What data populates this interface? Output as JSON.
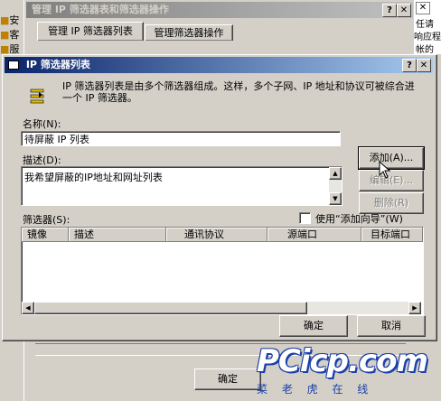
{
  "bg_window": {
    "title": "管理 IP 筛选器表和筛选器操作",
    "tabs": [
      "管理 IP 筛选器列表",
      "管理筛选器操作"
    ],
    "ok_label": "确定",
    "side_items": [
      "安",
      "客",
      "服"
    ],
    "right_items": [
      "任请",
      "响应程",
      "帐的"
    ]
  },
  "dialog": {
    "title": "IP 筛选器列表",
    "description": "IP 筛选器列表是由多个筛选器组成。这样，多个子网、IP 地址和协议可被综合进一个 IP 筛选器。",
    "name_label": "名称(N):",
    "name_value": "待屏蔽 IP 列表",
    "desc_label": "描述(D):",
    "desc_value": "我希望屏蔽的IP地址和网址列表",
    "buttons": {
      "add": "添加(A)...",
      "edit": "编辑(E)...",
      "delete": "删除(R)"
    },
    "filters_label": "筛选器(S):",
    "wizard_label": "使用“添加向导”(W)",
    "columns": [
      "镜像",
      "描述",
      "通讯协议",
      "源端口",
      "目标端口"
    ],
    "ok": "确定",
    "cancel": "取消"
  },
  "watermark": {
    "brand": "PCicp.com",
    "sub": "菜 老 虎 在 线"
  },
  "colors": {
    "title_active": "#0a246a",
    "face": "#d4d0c8",
    "watermark_blue": "#1a3fa8"
  }
}
